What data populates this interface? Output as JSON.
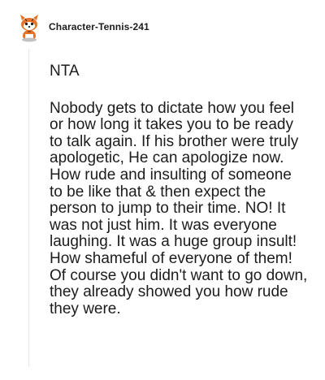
{
  "comment": {
    "username": "Character-Tennis-241",
    "avatar_icon": "snoo-avatar-icon",
    "verdict": "NTA",
    "body": "Nobody gets to dictate how you feel or how long it takes you to be ready to talk again. If his brother were truly apologetic, He can apologize now. How rude and insulting of someone to be like that & then expect the person to jump to their time. NO! It was not just him. It was everyone laughing. It was a huge group insult! How shameful of everyone of them! Of course you didn't want to go down, they already showed you how rude they were."
  },
  "colors": {
    "text": "#1c1c1c",
    "thread_line": "#e4e6e8",
    "avatar_accent": "#e8742a"
  }
}
